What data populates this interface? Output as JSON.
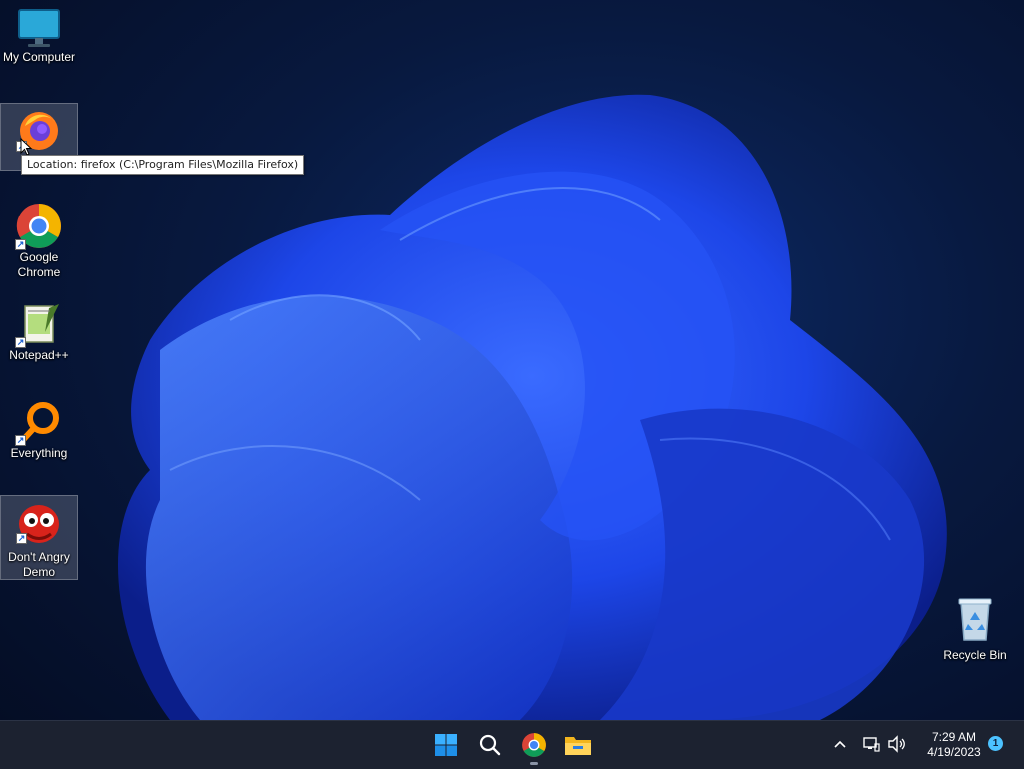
{
  "desktop": {
    "icons": [
      {
        "label": "My Computer"
      },
      {
        "label": ""
      },
      {
        "label": "Google Chrome"
      },
      {
        "label": "Notepad++"
      },
      {
        "label": "Everything"
      },
      {
        "label": "Don't Angry Demo"
      },
      {
        "label": "Recycle Bin"
      }
    ],
    "tooltip": "Location: firefox (C:\\Program Files\\Mozilla Firefox)"
  },
  "taskbar": {
    "pinned": [
      "start-icon",
      "search-icon",
      "chrome-icon",
      "file-explorer-icon"
    ],
    "clock": {
      "time": "7:29 AM",
      "date": "4/19/2023"
    },
    "notification_count": "1"
  },
  "colors": {
    "accent": "#1e4fff",
    "taskbar": "#1c2230"
  }
}
